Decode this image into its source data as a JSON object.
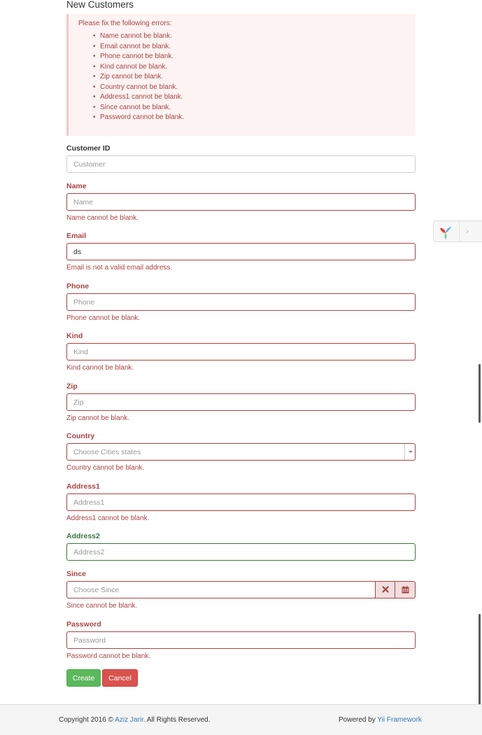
{
  "page": {
    "title": "New Customers"
  },
  "error_summary": {
    "heading": "Please fix the following errors:",
    "items": [
      "Name cannot be blank.",
      "Email cannot be blank.",
      "Phone cannot be blank.",
      "Kind cannot be blank.",
      "Zip cannot be blank.",
      "Country cannot be blank.",
      "Address1 cannot be blank.",
      "Since cannot be blank.",
      "Password cannot be blank."
    ]
  },
  "form": {
    "customer_id": {
      "label": "Customer ID",
      "placeholder": "Customer",
      "value": ""
    },
    "name": {
      "label": "Name",
      "placeholder": "Name",
      "value": "",
      "error": "Name cannot be blank."
    },
    "email": {
      "label": "Email",
      "placeholder": "Email",
      "value": "ds",
      "error": "Email is not a valid email address."
    },
    "phone": {
      "label": "Phone",
      "placeholder": "Phone",
      "value": "",
      "error": "Phone cannot be blank."
    },
    "kind": {
      "label": "Kind",
      "placeholder": "Kind",
      "value": "",
      "error": "Kind cannot be blank."
    },
    "zip": {
      "label": "Zip",
      "placeholder": "Zip",
      "value": "",
      "error": "Zip cannot be blank."
    },
    "country": {
      "label": "Country",
      "placeholder": "Choose Cities states",
      "error": "Country cannot be blank."
    },
    "address1": {
      "label": "Address1",
      "placeholder": "Address1",
      "value": "",
      "error": "Address1 cannot be blank."
    },
    "address2": {
      "label": "Address2",
      "placeholder": "Address2",
      "value": ""
    },
    "since": {
      "label": "Since",
      "placeholder": "Choose Since",
      "value": "",
      "error": "Since cannot be blank."
    },
    "password": {
      "label": "Password",
      "placeholder": "Password",
      "value": "",
      "error": "Password cannot be blank."
    }
  },
  "buttons": {
    "create": "Create",
    "cancel": "Cancel"
  },
  "footer": {
    "copyright_prefix": "Copyright 2016 © ",
    "author": "Aziz Jarir",
    "copyright_suffix": ". All Rights Reserved.",
    "powered_prefix": "Powered by ",
    "framework": "Yii Framework"
  },
  "debug_toolbar": {
    "icon": "yii-logo-icon",
    "toggle_icon": "chevron-right-icon"
  },
  "colors": {
    "error": "#a94442",
    "success": "#3c763d",
    "create_button": "#5cb85c",
    "cancel_button": "#d9534f",
    "link": "#337ab7"
  }
}
